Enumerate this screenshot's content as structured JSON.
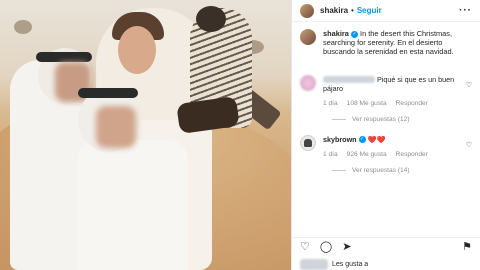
{
  "post": {
    "username": "shakira",
    "follow_label": "Seguir",
    "more_icon": "more-icon",
    "caption_user": "shakira",
    "caption": "In the desert this Christmas, searching for serenity. En el desierto buscando la serenidad en esta navidad."
  },
  "comments": [
    {
      "text": "Piqué si que es un buen pájaro",
      "time": "1 día",
      "likes": "108 Me gusta",
      "reply_label": "Responder",
      "view_replies": "Ver respuestas (12)"
    },
    {
      "username": "skybrown",
      "emoji": "❤️❤️",
      "time": "1 día",
      "likes": "926 Me gusta",
      "reply_label": "Responder",
      "view_replies": "Ver respuestas (14)"
    }
  ],
  "footer": {
    "likes_prefix": "Les gusta a"
  },
  "colors": {
    "accent": "#0095f6",
    "muted": "#8e8e8e",
    "text": "#262626"
  }
}
